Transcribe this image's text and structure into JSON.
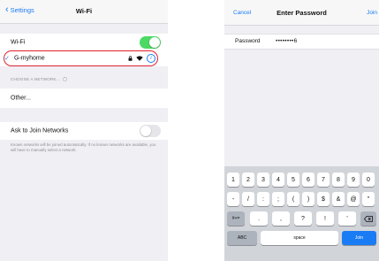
{
  "wifi_screen": {
    "back_label": "Settings",
    "title": "Wi-Fi",
    "wifi_label": "Wi-Fi",
    "wifi_enabled": true,
    "network_name": "G-myhome",
    "section_header": "CHOOSE A NETWORK...",
    "other_label": "Other...",
    "ask_label": "Ask to Join Networks",
    "ask_enabled": false,
    "footer_note": "Known networks will be joined automatically. If no known networks are available, you will have to manually select a network.",
    "icons": {
      "back": "chevron-left-icon",
      "check": "checkmark-icon",
      "lock": "lock-icon",
      "wifi": "wifi-signal-icon",
      "info": "info-icon",
      "spinner": "activity-spinner-icon"
    }
  },
  "password_screen": {
    "cancel_label": "Cancel",
    "title": "Enter Password",
    "join_label": "Join",
    "password_label": "Password",
    "password_value": "••••••••6",
    "keyboard": {
      "row1": [
        "1",
        "2",
        "3",
        "4",
        "5",
        "6",
        "7",
        "8",
        "9",
        "0"
      ],
      "row2": [
        "-",
        "/",
        ":",
        ";",
        "(",
        ")",
        "$",
        "&",
        "@",
        "\""
      ],
      "shift_label": "#+=",
      "row3": [
        ".",
        ",",
        "?",
        "!",
        "'"
      ],
      "mode_label": "ABC",
      "space_label": "space",
      "join_label": "Join"
    }
  },
  "colors": {
    "accent": "#1a7cf5",
    "toggle_on": "#4cd964",
    "highlight_outline": "#e0232d"
  }
}
